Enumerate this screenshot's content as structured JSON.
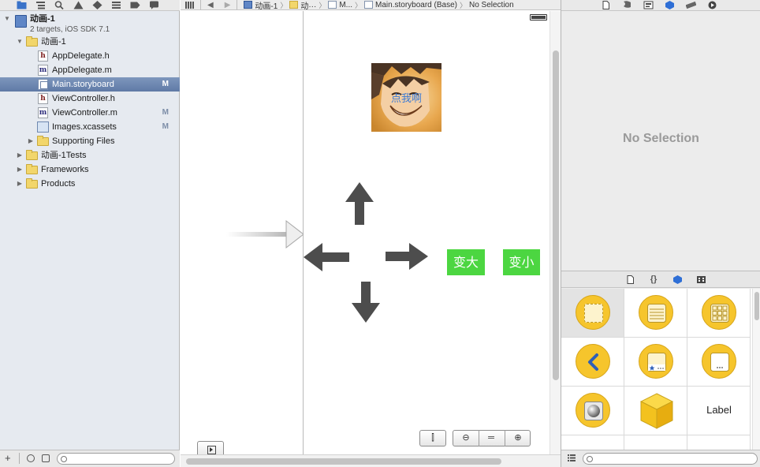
{
  "navigator": {
    "toolbar_icons": [
      "folder-icon",
      "structure-icon",
      "search-icon",
      "warning-icon",
      "test-icon",
      "debug-icon",
      "breakpoint-icon",
      "log-icon"
    ],
    "project": {
      "name": "动画-1",
      "subtitle": "2 targets, iOS SDK 7.1"
    },
    "items": [
      {
        "label": "动画-1",
        "badge": ""
      },
      {
        "label": "AppDelegate.h",
        "badge": ""
      },
      {
        "label": "AppDelegate.m",
        "badge": ""
      },
      {
        "label": "Main.storyboard",
        "badge": "M"
      },
      {
        "label": "ViewController.h",
        "badge": ""
      },
      {
        "label": "ViewController.m",
        "badge": "M"
      },
      {
        "label": "Images.xcassets",
        "badge": "M"
      },
      {
        "label": "Supporting Files",
        "badge": ""
      },
      {
        "label": "动画-1Tests",
        "badge": ""
      },
      {
        "label": "Frameworks",
        "badge": ""
      },
      {
        "label": "Products",
        "badge": ""
      }
    ]
  },
  "jumpbar": {
    "crumb_1": "动画-1",
    "crumb_2": "动···",
    "crumb_3": "M...",
    "crumb_4": "Main.storyboard (Base)",
    "crumb_5": "No Selection"
  },
  "canvas": {
    "image_caption": "点我啊",
    "grow_button": "变大",
    "shrink_button": "变小"
  },
  "inspector": {
    "toolbar_icons": [
      "file-icon",
      "quick-help-icon",
      "identity-icon",
      "attributes-icon",
      "size-icon",
      "connections-icon"
    ],
    "empty_state": "No Selection"
  },
  "library": {
    "tab_icons": [
      "file-template-icon",
      "code-snippet-icon",
      "object-icon",
      "media-icon"
    ],
    "label_cell": "Label"
  },
  "colors": {
    "green_button": "#4cd641",
    "selection": "#6f88b1",
    "library_yellow": "#f6c52c"
  }
}
